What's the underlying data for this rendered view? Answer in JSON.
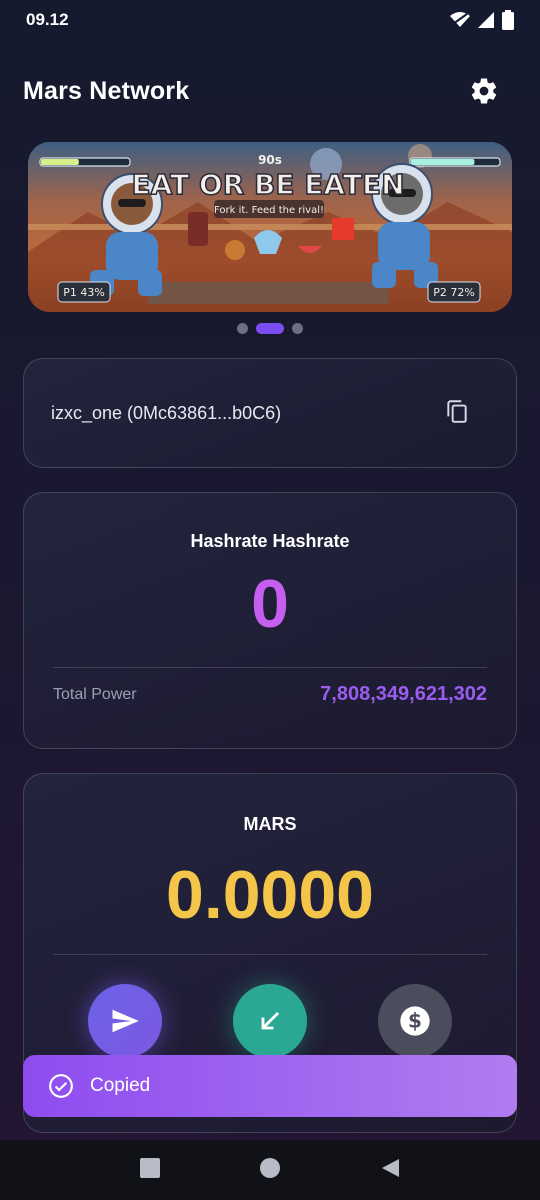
{
  "status_bar": {
    "time": "09.12"
  },
  "header": {
    "title": "Mars Network"
  },
  "banner": {
    "title": "EAT OR BE EATEN",
    "tagline": "Fork it. Feed the rival!",
    "badge": "90s",
    "player1": "P1 43%",
    "player2": "P2 72%",
    "player1_health": 0.43,
    "player2_health": 0.72,
    "slides": 3,
    "active_slide": 2
  },
  "wallet": {
    "label": "izxc_one (0Mc63861...b0C6)"
  },
  "hashrate": {
    "title": "Hashrate Hashrate",
    "value": "0",
    "power_label": "Total Power",
    "power_value": "7,808,349,621,302"
  },
  "balance": {
    "title": "MARS",
    "value": "0.0000"
  },
  "actions": [
    {
      "icon": "send-icon"
    },
    {
      "icon": "receive-icon"
    },
    {
      "icon": "dollar-icon"
    }
  ],
  "toast": {
    "text": "Copied"
  },
  "colors": {
    "accent_purple": "#7b4cf0",
    "hashrate_value": "#c65ef0",
    "power_value": "#9b5cf0",
    "balance_gold": "#f3c64a",
    "receive_green": "#2aa894"
  }
}
